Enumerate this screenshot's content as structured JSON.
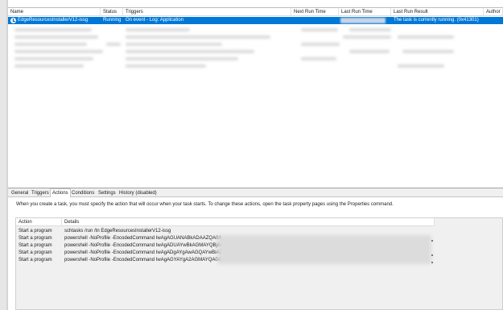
{
  "columns": {
    "name": "Name",
    "status": "Status",
    "triggers": "Triggers",
    "next_run_time": "Next Run Time",
    "last_run_time": "Last Run Time",
    "last_run_result": "Last Run Result",
    "author": "Author"
  },
  "selected_task": {
    "name": "EdgeResourcesInstallerV12-issg",
    "status": "Running",
    "trigger": "On event - Log: Application",
    "last_run_result": "The task is currently running. (0x41301)"
  },
  "tabs": [
    {
      "label": "General"
    },
    {
      "label": "Triggers"
    },
    {
      "label": "Actions"
    },
    {
      "label": "Conditions"
    },
    {
      "label": "Settings"
    },
    {
      "label": "History (disabled)"
    }
  ],
  "actions_pane": {
    "description": "When you create a task, you must specify the action that will occur when your task starts.  To change these actions, open the task property pages using the Properties command.",
    "headers": {
      "action": "Action",
      "details": "Details"
    },
    "rows": [
      {
        "action": "Start a program",
        "details": "schtasks /run /tn EdgeResourcesInstallerV12-issg"
      },
      {
        "action": "Start a program",
        "details": "powershell -NoProfile -EncodedCommand IwAgAGUANABkADAAZQA0ADYA"
      },
      {
        "action": "Start a program",
        "details": "powershell -NoProfile -EncodedCommand IwAgADUAYwBkAGMAYQBjAGQA"
      },
      {
        "action": "Start a program",
        "details": "powershell -NoProfile -EncodedCommand IwAgADgAYgAwAGQAYwBiADgA"
      },
      {
        "action": "Start a program",
        "details": "powershell -NoProfile -EncodedCommand IwAgAGYAYgA2AGMAYQA0AGEA"
      }
    ]
  },
  "colors": {
    "selection": "#0078d7",
    "tab_strip": "#f0f0f0",
    "pane_background": "#f0f0f0"
  }
}
